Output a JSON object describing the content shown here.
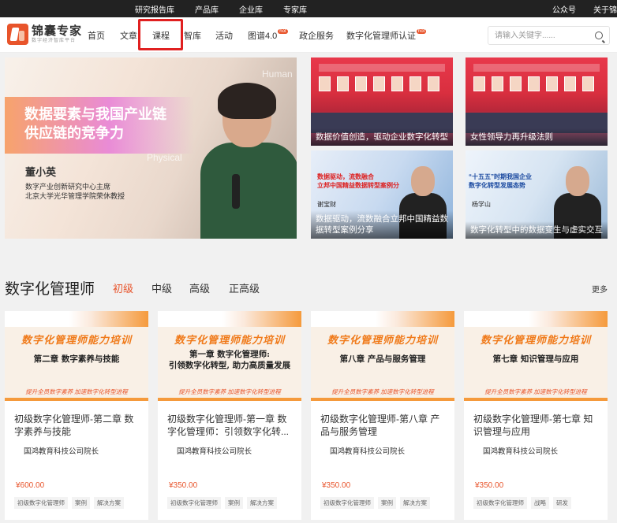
{
  "topbar": {
    "center_links": [
      "研究报告库",
      "产品库",
      "企业库",
      "专家库"
    ],
    "right_links": [
      "公众号",
      "关于锦"
    ]
  },
  "nav": {
    "logo_text": "锦囊专家",
    "logo_sub": "数字经济智库平台",
    "items": [
      {
        "label": "首页",
        "hot": ""
      },
      {
        "label": "文章",
        "hot": ""
      },
      {
        "label": "课程",
        "hot": ""
      },
      {
        "label": "智库",
        "hot": ""
      },
      {
        "label": "活动",
        "hot": ""
      },
      {
        "label": "图谱4.0",
        "hot": "hot"
      },
      {
        "label": "政企服务",
        "hot": ""
      },
      {
        "label": "数字化管理师认证",
        "hot": "hot"
      }
    ],
    "search_placeholder": "请输入关键字......"
  },
  "hero": {
    "title_line1": "数据要素与我国产业链",
    "title_line2": "供应链的竞争力",
    "speaker": "董小英",
    "role_line1": "数字产业创新研究中心主席",
    "role_line2": "北京大学光华管理学院荣休教授",
    "watermark1": "Human",
    "watermark2": "Physical"
  },
  "thumbs": [
    {
      "caption": "数据价值创造，驱动企业数字化转型"
    },
    {
      "caption": "女性领导力再升级法则"
    },
    {
      "caption": "数据驱动，流数融合立邦中国精益数据转型案例分享",
      "headline": "数据驱动，流数融合\n立邦中国精益数据转型案例分",
      "speaker": "谢宝财"
    },
    {
      "caption": "数字化转型中的数据变生与虚实交互",
      "headline": "“十五五”时期我国企业\n数字化转型发展态势",
      "speaker": "杨学山"
    }
  ],
  "section": {
    "title": "数字化管理师",
    "tabs": [
      "初级",
      "中级",
      "高级",
      "正高级"
    ],
    "active_tab": "初级",
    "more": "更多"
  },
  "courses": [
    {
      "banner": "数字化管理师能力培训",
      "chapter": "第二章 数字素养与技能",
      "slogan": "提升全员数字素养  加速数字化转型进程",
      "title": "初级数字化管理师-第二章 数字素养与技能",
      "org": "国鸿教育科技公司院长",
      "price": "¥600.00",
      "tags": [
        "初级数字化管理师",
        "案例",
        "解决方案"
      ]
    },
    {
      "banner": "数字化管理师能力培训",
      "chapter": "第一章 数字化管理师:\n引领数字化转型, 助力高质量发展",
      "slogan": "提升全员数字素养  加速数字化转型进程",
      "title": "初级数字化管理师-第一章 数字化管理师：引领数字化转...",
      "org": "国鸿教育科技公司院长",
      "price": "¥350.00",
      "tags": [
        "初级数字化管理师",
        "案例",
        "解决方案"
      ]
    },
    {
      "banner": "数字化管理师能力培训",
      "chapter": "第八章 产品与服务管理",
      "slogan": "提升全员数字素养  加速数字化转型进程",
      "title": "初级数字化管理师-第八章 产品与服务管理",
      "org": "国鸿教育科技公司院长",
      "price": "¥350.00",
      "tags": [
        "初级数字化管理师",
        "案例",
        "解决方案"
      ]
    },
    {
      "banner": "数字化管理师能力培训",
      "chapter": "第七章 知识管理与应用",
      "slogan": "提升全员数字素养  加速数字化转型进程",
      "title": "初级数字化管理师-第七章 知识管理与应用",
      "org": "国鸿教育科技公司院长",
      "price": "¥350.00",
      "tags": [
        "初级数字化管理师",
        "战略",
        "研发"
      ]
    }
  ],
  "colors": {
    "accent": "#e8542b",
    "highlight_box": "#e02020",
    "topbar": "#222222"
  }
}
